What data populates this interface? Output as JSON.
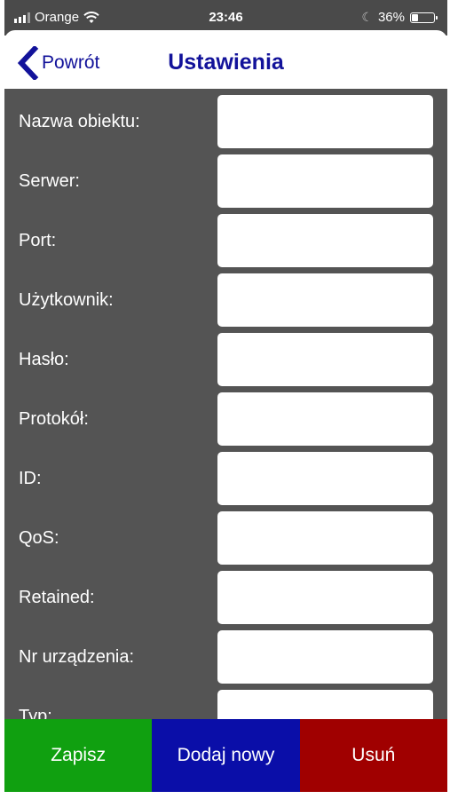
{
  "status_bar": {
    "carrier": "Orange",
    "time": "23:46",
    "battery": "36%",
    "battery_level": 0.36
  },
  "nav": {
    "back_label": "Powrót",
    "title": "Ustawienia"
  },
  "form": {
    "fields": [
      {
        "label": "Nazwa obiektu:",
        "value": ""
      },
      {
        "label": "Serwer:",
        "value": ""
      },
      {
        "label": "Port:",
        "value": ""
      },
      {
        "label": "Użytkownik:",
        "value": ""
      },
      {
        "label": "Hasło:",
        "value": ""
      },
      {
        "label": "Protokół:",
        "value": ""
      },
      {
        "label": "ID:",
        "value": ""
      },
      {
        "label": "QoS:",
        "value": ""
      },
      {
        "label": "Retained:",
        "value": ""
      },
      {
        "label": "Nr urządzenia:",
        "value": ""
      },
      {
        "label": "Typ:",
        "value": ""
      }
    ]
  },
  "actions": {
    "save_label": "Zapisz",
    "add_label": "Dodaj nowy",
    "delete_label": "Usuń"
  },
  "colors": {
    "accent": "#12129a",
    "background": "#545454",
    "save": "#10a010",
    "add": "#0a0ea8",
    "delete": "#a00000"
  }
}
